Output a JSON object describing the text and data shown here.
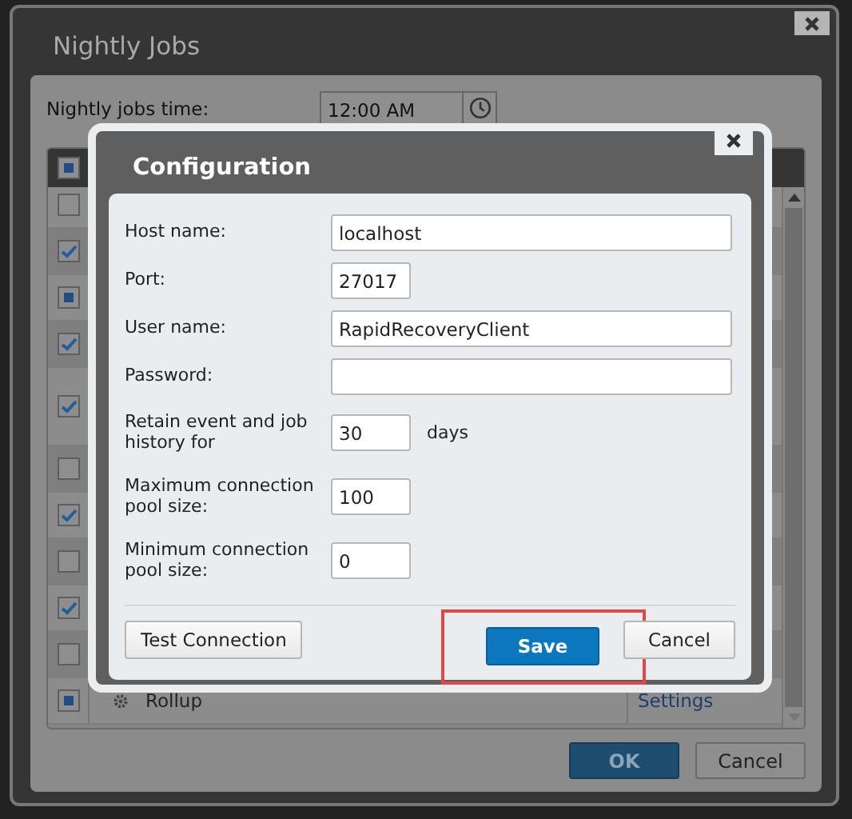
{
  "window": {
    "title": "Nightly Jobs"
  },
  "time": {
    "label": "Nightly jobs time:",
    "value": "12:00 AM"
  },
  "table": {
    "header_checkbox": {
      "checked": false,
      "partial": true
    },
    "rows": [
      {
        "checked": false,
        "partial": false
      },
      {
        "checked": true,
        "partial": false
      },
      {
        "checked": false,
        "partial": true
      },
      {
        "checked": true,
        "partial": false
      },
      {
        "checked": true,
        "partial": false
      },
      {
        "checked": false,
        "partial": false
      },
      {
        "checked": true,
        "partial": false
      },
      {
        "checked": false,
        "partial": false
      },
      {
        "checked": true,
        "partial": false
      },
      {
        "checked": false,
        "partial": false
      },
      {
        "checked": false,
        "partial": true,
        "name": "Rollup",
        "action": "Settings"
      }
    ]
  },
  "buttons": [
    {
      "label": "OK",
      "primary": true
    },
    {
      "label": "Cancel",
      "primary": false
    }
  ],
  "dialog": {
    "title": "Configuration",
    "fields": [
      {
        "label": "Host name:",
        "value": "localhost",
        "kind": "text"
      },
      {
        "label": "Port:",
        "value": "27017",
        "kind": "number"
      },
      {
        "label": "User name:",
        "value": "RapidRecoveryClient",
        "kind": "text"
      },
      {
        "label": "Password:",
        "kind": "password"
      },
      {
        "label": "Retain event and job history for",
        "value": "30",
        "kind": "number",
        "unit": "days"
      },
      {
        "label": "Maximum connection pool size:",
        "value": "100",
        "kind": "number"
      },
      {
        "label": "Minimum connection pool size:",
        "value": "0",
        "kind": "number"
      }
    ],
    "buttons": [
      {
        "label": "Test Connection",
        "primary": false,
        "highlighted": false
      },
      {
        "label": "Save",
        "primary": true,
        "highlighted": true
      },
      {
        "label": "Cancel",
        "primary": false,
        "highlighted": false
      }
    ]
  }
}
